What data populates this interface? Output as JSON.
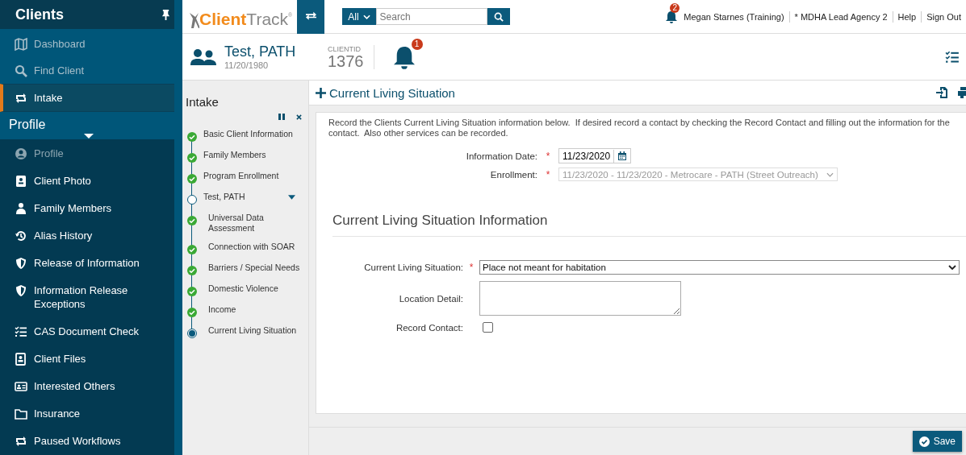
{
  "sidebar": {
    "title": "Clients",
    "pinned": true,
    "items": [
      {
        "label": "Dashboard",
        "disabled": true,
        "selected": false
      },
      {
        "label": "Find Client",
        "disabled": true,
        "selected": false
      },
      {
        "label": "Intake",
        "disabled": false,
        "selected": true
      }
    ],
    "section": {
      "title": "Profile",
      "expanded": true,
      "items": [
        {
          "label": "Profile",
          "disabled": true
        },
        {
          "label": "Client Photo",
          "disabled": false
        },
        {
          "label": "Family Members",
          "disabled": false
        },
        {
          "label": "Alias History",
          "disabled": false
        },
        {
          "label": "Release of Information",
          "disabled": false
        },
        {
          "label": "Information Release Exceptions",
          "disabled": false
        },
        {
          "label": "CAS Document Check",
          "disabled": false
        },
        {
          "label": "Client Files",
          "disabled": false
        },
        {
          "label": "Interested Others",
          "disabled": false
        },
        {
          "label": "Insurance",
          "disabled": false
        },
        {
          "label": "Paused Workflows",
          "disabled": false
        }
      ]
    }
  },
  "topbar": {
    "logo": {
      "first": "Client",
      "second": "Track",
      "mark": "®"
    },
    "search": {
      "scope": "All",
      "placeholder": "Search"
    },
    "notifications": "2",
    "user": "Megan Starnes (Training)",
    "agency": "* MDHA Lead Agency 2",
    "links": [
      "Help",
      "Sign Out"
    ]
  },
  "client": {
    "name": "Test, PATH",
    "birth_date": "11/20/1980",
    "id_label": "CLIENTID",
    "id": "1376",
    "alerts": "1"
  },
  "workflow": {
    "title": "Intake",
    "steps": [
      {
        "label": "Basic Client Information",
        "kind": "done"
      },
      {
        "label": "Family Members",
        "kind": "done"
      },
      {
        "label": "Program Enrollment",
        "kind": "done"
      },
      {
        "label": "Test, PATH",
        "kind": "open",
        "expanded": true,
        "children": [
          {
            "label": "Universal Data Assessment",
            "kind": "done"
          },
          {
            "label": "Connection with SOAR",
            "kind": "done"
          },
          {
            "label": "Barriers / Special Needs",
            "kind": "done"
          },
          {
            "label": "Domestic Violence",
            "kind": "done"
          },
          {
            "label": "Income",
            "kind": "done"
          },
          {
            "label": "Current Living Situation",
            "kind": "current"
          }
        ]
      }
    ]
  },
  "form": {
    "title": "Current Living Situation",
    "instructions": "Record the Clients Current Living Situation information below.  If desired record a contact by checking the Record Contact and filling out the information for the contact.  Also other services can be recorded.",
    "top_fields": [
      {
        "kind": "date",
        "label": "Information Date:",
        "required_mark": "*",
        "value": "11/23/2020",
        "disabled": false
      },
      {
        "kind": "select",
        "label": "Enrollment:",
        "required_mark": "*",
        "value": "11/23/2020 - 11/23/2020 - Metrocare - PATH (Street Outreach)",
        "disabled": true
      }
    ],
    "section_title": "Current Living Situation Information",
    "fields": [
      {
        "kind": "select",
        "label": "Current Living Situation:",
        "required_mark": "*",
        "value": "Place not meant for habitation"
      },
      {
        "kind": "textarea",
        "label": "Location Detail:"
      },
      {
        "kind": "checkbox",
        "label": "Record Contact:",
        "checked": false
      }
    ],
    "save": "Save"
  }
}
